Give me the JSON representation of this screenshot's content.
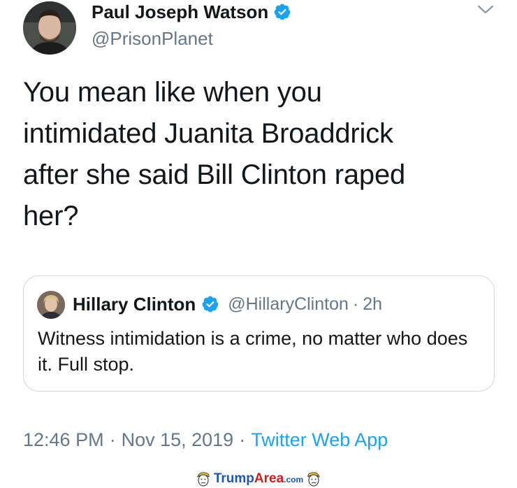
{
  "tweet": {
    "author": {
      "display_name": "Paul Joseph Watson",
      "handle": "@PrisonPlanet",
      "verified": true
    },
    "text": "You mean like when you\nintimidated Juanita Broaddrick\nafter she said Bill Clinton raped\nher?",
    "quoted": {
      "display_name": "Hillary Clinton",
      "handle": "@HillaryClinton",
      "dot": "·",
      "time": "2h",
      "text": "Witness intimidation is a crime, no matter who does it. Full stop."
    },
    "meta": {
      "time": "12:46 PM",
      "sep": "·",
      "date": "Nov 15, 2019",
      "source": "Twitter Web App"
    }
  },
  "watermark": {
    "trump": "Trump",
    "area": "Area",
    "com": ".com"
  },
  "icons": {
    "verified": "verified-badge-icon",
    "menu": "chevron-down-icon",
    "watermark_face": "caricature-face-icon"
  },
  "colors": {
    "text": "#14171a",
    "secondary": "#657786",
    "link": "#1da1f2",
    "verified": "#1da1f2",
    "border": "#ccd6dd",
    "watermark_blue": "#1f56b3",
    "watermark_red": "#c62121"
  }
}
